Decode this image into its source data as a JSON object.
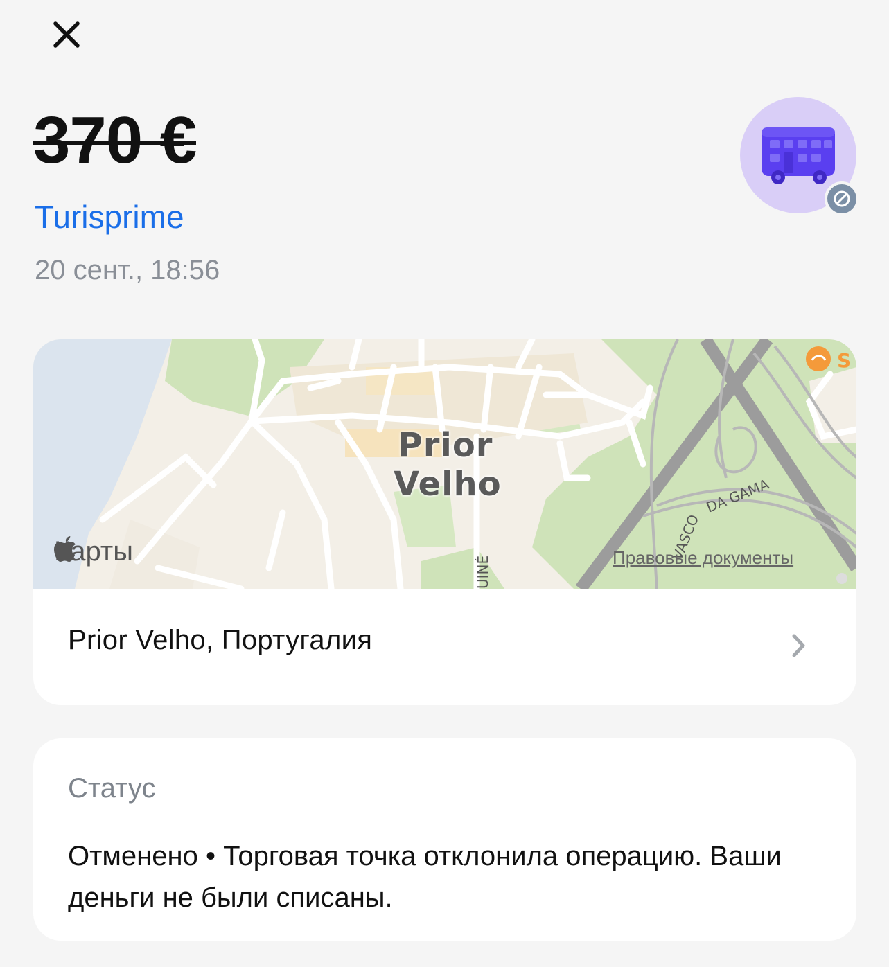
{
  "header": {
    "close_icon": "close-icon"
  },
  "transaction": {
    "amount": "370 €",
    "merchant": "Turisprime",
    "datetime": "20 сент., 18:56",
    "avatar_icon": "bus-icon",
    "badge_icon": "blocked-icon"
  },
  "map": {
    "place_label_line1": "Prior",
    "place_label_line2": "Velho",
    "brand": "Карты",
    "legal": "Правовые документы",
    "road_label": "DA GAMA",
    "road_label2": "VASCO",
    "street_label": "UINÉ",
    "poi_label": "S"
  },
  "location": {
    "text": "Prior Velho, Португалия"
  },
  "status": {
    "title": "Статус",
    "text": "Отменено • Торговая точка отклонила операцию. Ваши деньги не были списаны."
  },
  "colors": {
    "accent_link": "#1a6ee8",
    "avatar_bg": "#d9cef7",
    "bus": "#5a3ff0",
    "badge": "#7b8fa6"
  }
}
